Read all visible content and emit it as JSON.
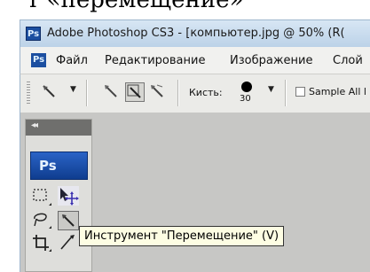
{
  "page_caption": "т «перемещение»",
  "window": {
    "title": "Adobe Photoshop CS3 - [компьютер.jpg @ 50% (R(",
    "app_icon": "photoshop-icon"
  },
  "menu": {
    "items": [
      "Файл",
      "Редактирование",
      "Изображение",
      "Слой"
    ]
  },
  "options": {
    "brush_label": "Кисть:",
    "brush_size": "30",
    "sample_all_label": "Sample All l"
  },
  "toolbox": {
    "collapse_glyph": "◂◂",
    "logo_text": "Ps"
  },
  "tooltip": {
    "text": "Инструмент \"Перемещение\" (V)"
  }
}
